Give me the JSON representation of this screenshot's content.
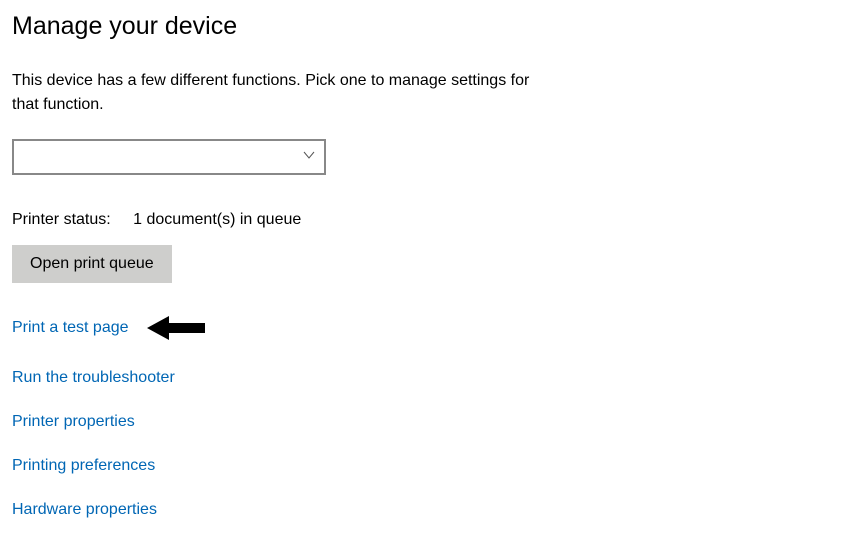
{
  "header": {
    "title": "Manage your device"
  },
  "description": "This device has a few different functions. Pick one to manage settings for that function.",
  "function_select": {
    "value": ""
  },
  "status": {
    "label": "Printer status:",
    "value": "1 document(s) in queue"
  },
  "buttons": {
    "open_queue": "Open print queue"
  },
  "links": {
    "print_test": "Print a test page",
    "run_troubleshooter": "Run the troubleshooter",
    "printer_properties": "Printer properties",
    "printing_preferences": "Printing preferences",
    "hardware_properties": "Hardware properties"
  }
}
